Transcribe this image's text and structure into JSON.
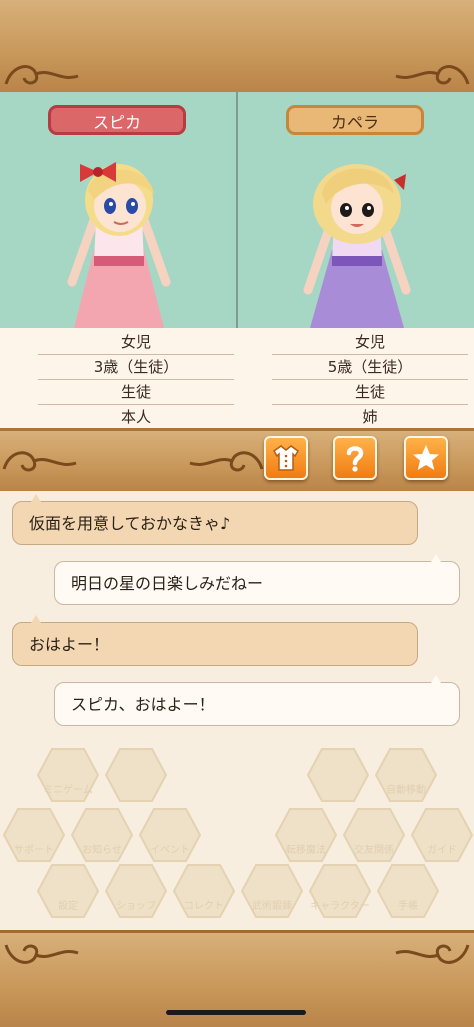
{
  "characters": [
    {
      "name": "スピカ",
      "info": [
        "女児",
        "3歳（生徒）",
        "生徒",
        "本人"
      ],
      "tag_color": "#dc6768"
    },
    {
      "name": "カペラ",
      "info": [
        "女児",
        "5歳（生徒）",
        "生徒",
        "姉"
      ],
      "tag_color": "#e9b877"
    }
  ],
  "action_buttons": [
    {
      "name": "outfit",
      "icon": "dress-icon"
    },
    {
      "name": "help",
      "icon": "question-icon"
    },
    {
      "name": "favorite",
      "icon": "star-icon"
    }
  ],
  "chat": [
    {
      "side": "left",
      "text": "仮面を用意しておかなきゃ♪"
    },
    {
      "side": "right",
      "text": "明日の星の日楽しみだねー"
    },
    {
      "side": "left",
      "text": "おはよー！"
    },
    {
      "side": "right",
      "text": "スピカ、おはよー！"
    }
  ],
  "background_menu": [
    "ミニゲーム",
    "自動移動",
    "サポート",
    "お知らせ",
    "イベント",
    "転移魔法",
    "交友関係",
    "ガイド",
    "設定",
    "ショップ",
    "コレクト",
    "武術鍛錬",
    "キャラクター",
    "手帳"
  ],
  "colors": {
    "bar": "#c8975a",
    "panel": "#a6d6c4",
    "button": "#f07c12"
  }
}
